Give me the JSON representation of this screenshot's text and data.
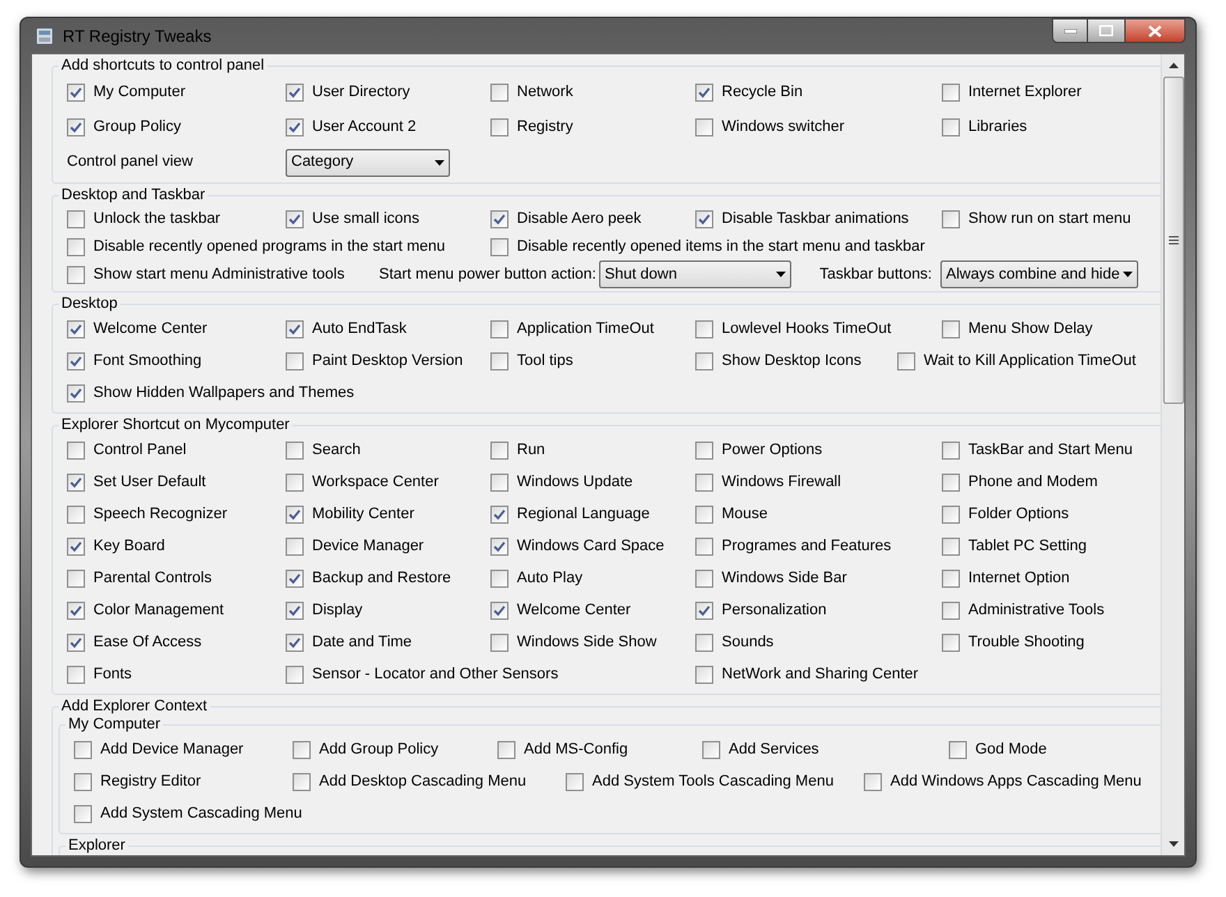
{
  "window": {
    "title": "RT Registry Tweaks"
  },
  "sections": [
    {
      "title": "Add shortcuts to control panel",
      "rows": [
        [
          {
            "kind": "checkbox",
            "label": "My Computer",
            "checked": true
          },
          {
            "kind": "checkbox",
            "label": "User Directory",
            "checked": true
          },
          {
            "kind": "checkbox",
            "label": "Network",
            "checked": false
          },
          {
            "kind": "checkbox",
            "label": "Recycle Bin",
            "checked": true
          },
          {
            "kind": "checkbox",
            "label": "Internet Explorer",
            "checked": false
          }
        ],
        [
          {
            "kind": "checkbox",
            "label": "Group Policy",
            "checked": true
          },
          {
            "kind": "checkbox",
            "label": "User Account 2",
            "checked": true
          },
          {
            "kind": "checkbox",
            "label": "Registry",
            "checked": false
          },
          {
            "kind": "checkbox",
            "label": "Windows switcher",
            "checked": false
          },
          {
            "kind": "checkbox",
            "label": "Libraries",
            "checked": false
          }
        ],
        [
          {
            "kind": "label",
            "text": "Control panel view"
          },
          {
            "kind": "dropdown",
            "value": "Category"
          }
        ]
      ]
    },
    {
      "title": "Desktop and Taskbar",
      "rows": [
        [
          {
            "kind": "checkbox",
            "label": "Unlock the taskbar",
            "checked": false
          },
          {
            "kind": "checkbox",
            "label": "Use small icons",
            "checked": true
          },
          {
            "kind": "checkbox",
            "label": "Disable Aero peek",
            "checked": true
          },
          {
            "kind": "checkbox",
            "label": "Disable Taskbar animations",
            "checked": true
          },
          {
            "kind": "checkbox",
            "label": "Show run on start menu",
            "checked": false
          }
        ],
        [
          {
            "kind": "checkbox",
            "label": "Disable recently opened programs in the start menu",
            "checked": false
          },
          {
            "kind": "checkbox",
            "label": "Disable recently opened items in the start menu and taskbar",
            "checked": false
          }
        ],
        [
          {
            "kind": "checkbox",
            "label": "Show start menu Administrative tools",
            "checked": false
          },
          {
            "kind": "label",
            "text": "Start menu power button action:"
          },
          {
            "kind": "dropdown",
            "value": "Shut down"
          },
          {
            "kind": "label",
            "text": "Taskbar buttons:"
          },
          {
            "kind": "dropdown",
            "value": "Always combine and hide"
          }
        ]
      ]
    },
    {
      "title": "Desktop",
      "rows": [
        [
          {
            "kind": "checkbox",
            "label": "Welcome Center",
            "checked": true
          },
          {
            "kind": "checkbox",
            "label": "Auto EndTask",
            "checked": true
          },
          {
            "kind": "checkbox",
            "label": "Application TimeOut",
            "checked": false
          },
          {
            "kind": "checkbox",
            "label": "Lowlevel Hooks TimeOut",
            "checked": false
          },
          {
            "kind": "checkbox",
            "label": "Menu Show Delay",
            "checked": false
          }
        ],
        [
          {
            "kind": "checkbox",
            "label": "Font Smoothing",
            "checked": true
          },
          {
            "kind": "checkbox",
            "label": "Paint Desktop Version",
            "checked": false
          },
          {
            "kind": "checkbox",
            "label": "Tool tips",
            "checked": false
          },
          {
            "kind": "checkbox",
            "label": "Show Desktop Icons",
            "checked": false
          },
          {
            "kind": "checkbox",
            "label": "Wait to Kill Application TimeOut",
            "checked": false
          }
        ],
        [
          {
            "kind": "checkbox",
            "label": "Show Hidden Wallpapers and Themes",
            "checked": true
          }
        ]
      ]
    },
    {
      "title": "Explorer Shortcut on Mycomputer",
      "rows": [
        [
          {
            "kind": "checkbox",
            "label": "Control Panel",
            "checked": false
          },
          {
            "kind": "checkbox",
            "label": "Search",
            "checked": false
          },
          {
            "kind": "checkbox",
            "label": "Run",
            "checked": false
          },
          {
            "kind": "checkbox",
            "label": "Power Options",
            "checked": false
          },
          {
            "kind": "checkbox",
            "label": "TaskBar and Start Menu",
            "checked": false
          }
        ],
        [
          {
            "kind": "checkbox",
            "label": "Set User Default",
            "checked": true
          },
          {
            "kind": "checkbox",
            "label": "Workspace Center",
            "checked": false
          },
          {
            "kind": "checkbox",
            "label": "Windows Update",
            "checked": false
          },
          {
            "kind": "checkbox",
            "label": "Windows Firewall",
            "checked": false
          },
          {
            "kind": "checkbox",
            "label": "Phone and Modem",
            "checked": false
          }
        ],
        [
          {
            "kind": "checkbox",
            "label": "Speech Recognizer",
            "checked": false
          },
          {
            "kind": "checkbox",
            "label": "Mobility Center",
            "checked": true
          },
          {
            "kind": "checkbox",
            "label": "Regional Language",
            "checked": true
          },
          {
            "kind": "checkbox",
            "label": "Mouse",
            "checked": false
          },
          {
            "kind": "checkbox",
            "label": "Folder Options",
            "checked": false
          }
        ],
        [
          {
            "kind": "checkbox",
            "label": "Key Board",
            "checked": true
          },
          {
            "kind": "checkbox",
            "label": "Device Manager",
            "checked": false
          },
          {
            "kind": "checkbox",
            "label": "Windows Card Space",
            "checked": true
          },
          {
            "kind": "checkbox",
            "label": "Programes and Features",
            "checked": false
          },
          {
            "kind": "checkbox",
            "label": "Tablet PC Setting",
            "checked": false
          }
        ],
        [
          {
            "kind": "checkbox",
            "label": "Parental Controls",
            "checked": false
          },
          {
            "kind": "checkbox",
            "label": "Backup and Restore",
            "checked": true
          },
          {
            "kind": "checkbox",
            "label": "Auto Play",
            "checked": false
          },
          {
            "kind": "checkbox",
            "label": "Windows Side Bar",
            "checked": false
          },
          {
            "kind": "checkbox",
            "label": "Internet Option",
            "checked": false
          }
        ],
        [
          {
            "kind": "checkbox",
            "label": "Color Management",
            "checked": true
          },
          {
            "kind": "checkbox",
            "label": "Display",
            "checked": true
          },
          {
            "kind": "checkbox",
            "label": "Welcome Center",
            "checked": true
          },
          {
            "kind": "checkbox",
            "label": "Personalization",
            "checked": true
          },
          {
            "kind": "checkbox",
            "label": "Administrative Tools",
            "checked": false
          }
        ],
        [
          {
            "kind": "checkbox",
            "label": "Ease Of Access",
            "checked": true
          },
          {
            "kind": "checkbox",
            "label": "Date and Time",
            "checked": true
          },
          {
            "kind": "checkbox",
            "label": "Windows Side Show",
            "checked": false
          },
          {
            "kind": "checkbox",
            "label": "Sounds",
            "checked": false
          },
          {
            "kind": "checkbox",
            "label": "Trouble Shooting",
            "checked": false
          }
        ],
        [
          {
            "kind": "checkbox",
            "label": "Fonts",
            "checked": false
          },
          {
            "kind": "checkbox",
            "label": "Sensor - Locator and Other Sensors",
            "checked": false
          },
          "",
          {
            "kind": "checkbox",
            "label": "NetWork and Sharing Center",
            "checked": false
          }
        ]
      ]
    },
    {
      "title": "Add Explorer Context",
      "groups": [
        {
          "title": "My Computer",
          "items": [
            {
              "kind": "checkbox",
              "label": "Add Device Manager",
              "checked": false
            },
            {
              "kind": "checkbox",
              "label": "Add Group Policy",
              "checked": false
            },
            {
              "kind": "checkbox",
              "label": "Add MS-Config",
              "checked": false
            },
            {
              "kind": "checkbox",
              "label": "Add Services",
              "checked": false
            },
            {
              "kind": "checkbox",
              "label": "God Mode",
              "checked": false
            },
            {
              "kind": "checkbox",
              "label": "Registry Editor",
              "checked": false
            },
            {
              "kind": "checkbox",
              "label": "Add Desktop Cascading Menu",
              "checked": false
            },
            {
              "kind": "checkbox",
              "label": "Add System Tools Cascading Menu",
              "checked": false
            },
            {
              "kind": "checkbox",
              "label": "Add Windows Apps Cascading Menu",
              "checked": false
            },
            {
              "kind": "checkbox",
              "label": "Add System Cascading Menu",
              "checked": false
            }
          ]
        },
        {
          "title": "Explorer"
        }
      ]
    }
  ]
}
